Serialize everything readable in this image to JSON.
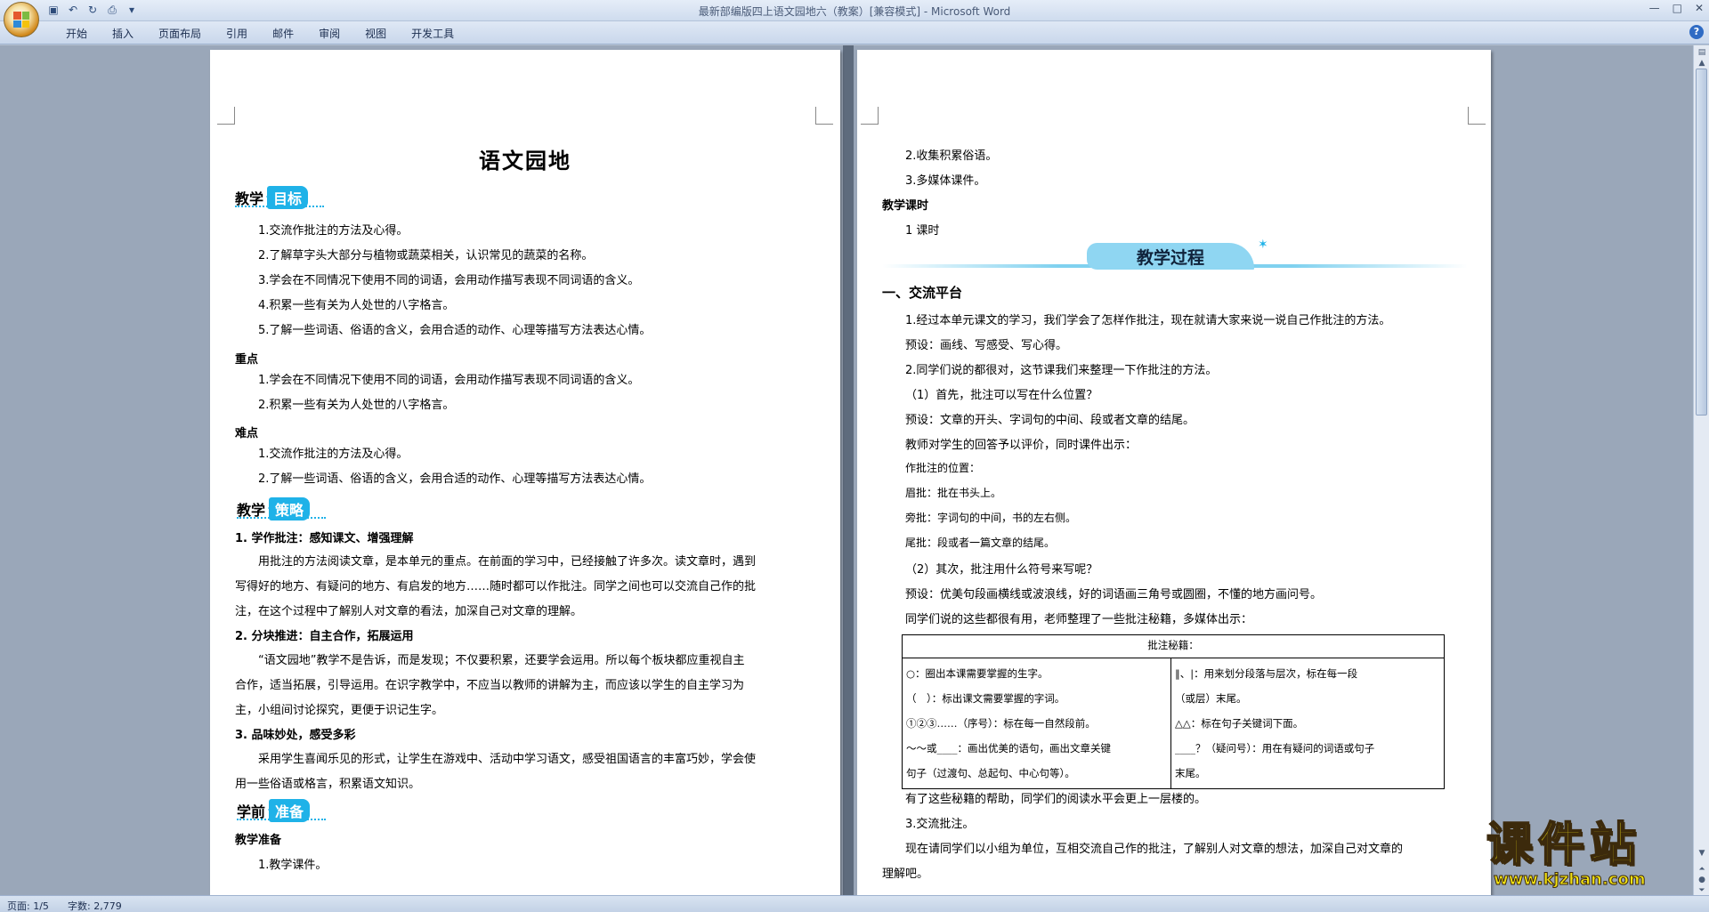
{
  "window": {
    "title": "最新部编版四上语文园地六（教案）[兼容模式] - Microsoft Word"
  },
  "ribbon": {
    "tabs": [
      "开始",
      "插入",
      "页面布局",
      "引用",
      "邮件",
      "审阅",
      "视图",
      "开发工具"
    ]
  },
  "page1": {
    "doc_title": "语文园地",
    "goals_head": {
      "label": "教学",
      "pill": "目标"
    },
    "goals": [
      "1.交流作批注的方法及心得。",
      "2.了解草字头大部分与植物或蔬菜相关，认识常见的蔬菜的名称。",
      "3.学会在不同情况下使用不同的词语，会用动作描写表现不同词语的含义。",
      "4.积累一些有关为人处世的八字格言。",
      "5.了解一些词语、俗语的含义，会用合适的动作、心理等描写方法表达心情。"
    ],
    "key_label": "重点",
    "key_points": [
      "1.学会在不同情况下使用不同的词语，会用动作描写表现不同词语的含义。",
      "2.积累一些有关为人处世的八字格言。"
    ],
    "difficulty_label": "难点",
    "difficulty_points": [
      "1.交流作批注的方法及心得。",
      "2.了解一些词语、俗语的含义，会用合适的动作、心理等描写方法表达心情。"
    ],
    "strategy_head": {
      "label": "教学",
      "pill": "策略"
    },
    "s1_title": "1. 学作批注：感知课文、增强理解",
    "s1_lines": [
      "用批注的方法阅读文章，是本单元的重点。在前面的学习中，已经接触了许多次。读文章时，遇到",
      "写得好的地方、有疑问的地方、有启发的地方……随时都可以作批注。同学之间也可以交流自己作的批",
      "注，在这个过程中了解别人对文章的看法，加深自己对文章的理解。"
    ],
    "s2_title": "2. 分块推进：自主合作，拓展运用",
    "s2_lines": [
      "“语文园地”教学不是告诉，而是发现；不仅要积累，还要学会运用。所以每个板块都应重视自主",
      "合作，适当拓展，引导运用。在识字教学中，不应当以教师的讲解为主，而应该以学生的自主学习为",
      "主，小组间讨论探究，更便于识记生字。"
    ],
    "s3_title": "3. 品味妙处，感受多彩",
    "s3_lines": [
      "采用学生喜闻乐见的形式，让学生在游戏中、活动中学习语文，感受祖国语言的丰富巧妙，学会使",
      "用一些俗语或格言，积累语文知识。"
    ],
    "prep_head": {
      "label": "学前",
      "pill": "准备"
    },
    "prep_label": "教学准备",
    "prep_item": "1.教学课件。"
  },
  "page2": {
    "prep_items": [
      "2.收集积累俗语。",
      "3.多媒体课件。"
    ],
    "hours_label": "教学课时",
    "hours_value": "1 课时",
    "banner": "教学过程",
    "section1": "一、交流平台",
    "lines": [
      "1.经过本单元课文的学习，我们学会了怎样作批注，现在就请大家来说一说自己作批注的方法。",
      "预设：画线、写感受、写心得。",
      "2.同学们说的都很对，这节课我们来整理一下作批注的方法。",
      "（1）首先，批注可以写在什么位置？",
      "预设：文章的开头、字词句的中间、段或者文章的结尾。",
      "教师对学生的回答予以评价，同时课件出示："
    ],
    "note_lines": [
      "作批注的位置：",
      "眉批：批在书头上。",
      "旁批：字词句的中间，书的左右侧。",
      "尾批：段或者一篇文章的结尾。"
    ],
    "lines2": [
      "（2）其次，批注用什么符号来写呢？",
      "预设：优美句段画横线或波浪线，好的词语画三角号或圆圈，不懂的地方画问号。",
      "同学们说的这些都很有用，老师整理了一些批注秘籍，多媒体出示："
    ],
    "table": {
      "header": "批注秘籍：",
      "left": [
        "○：圈出本课需要掌握的生字。",
        "（　）：标出课文需要掌握的字词。",
        "①②③……（序号）：标在每一自然段前。",
        "～～或____：画出优美的语句，画出文章关键",
        "句子（过渡句、总起句、中心句等）。"
      ],
      "right": [
        "‖、|：用来划分段落与层次，标在每一段",
        "（或层）末尾。",
        "△△：标在句子关键词下面。",
        "____？（疑问号）：用在有疑问的词语或句子",
        "末尾。"
      ]
    },
    "lines3": [
      "有了这些秘籍的帮助，同学们的阅读水平会更上一层楼的。",
      "3.交流批注。",
      "现在请同学们以小组为单位，互相交流自己作的批注，了解别人对文章的想法，加深自己对文章的",
      "理解吧。"
    ]
  },
  "status": {
    "page": "页面: 1/5",
    "words": "字数: 2,779"
  },
  "watermark": {
    "brand": "课件站",
    "url": "www.kjzhan.com"
  },
  "colors": {
    "accent": "#1fb2e8",
    "banner": "#8fd6f2",
    "watermark": "#f2e212"
  }
}
